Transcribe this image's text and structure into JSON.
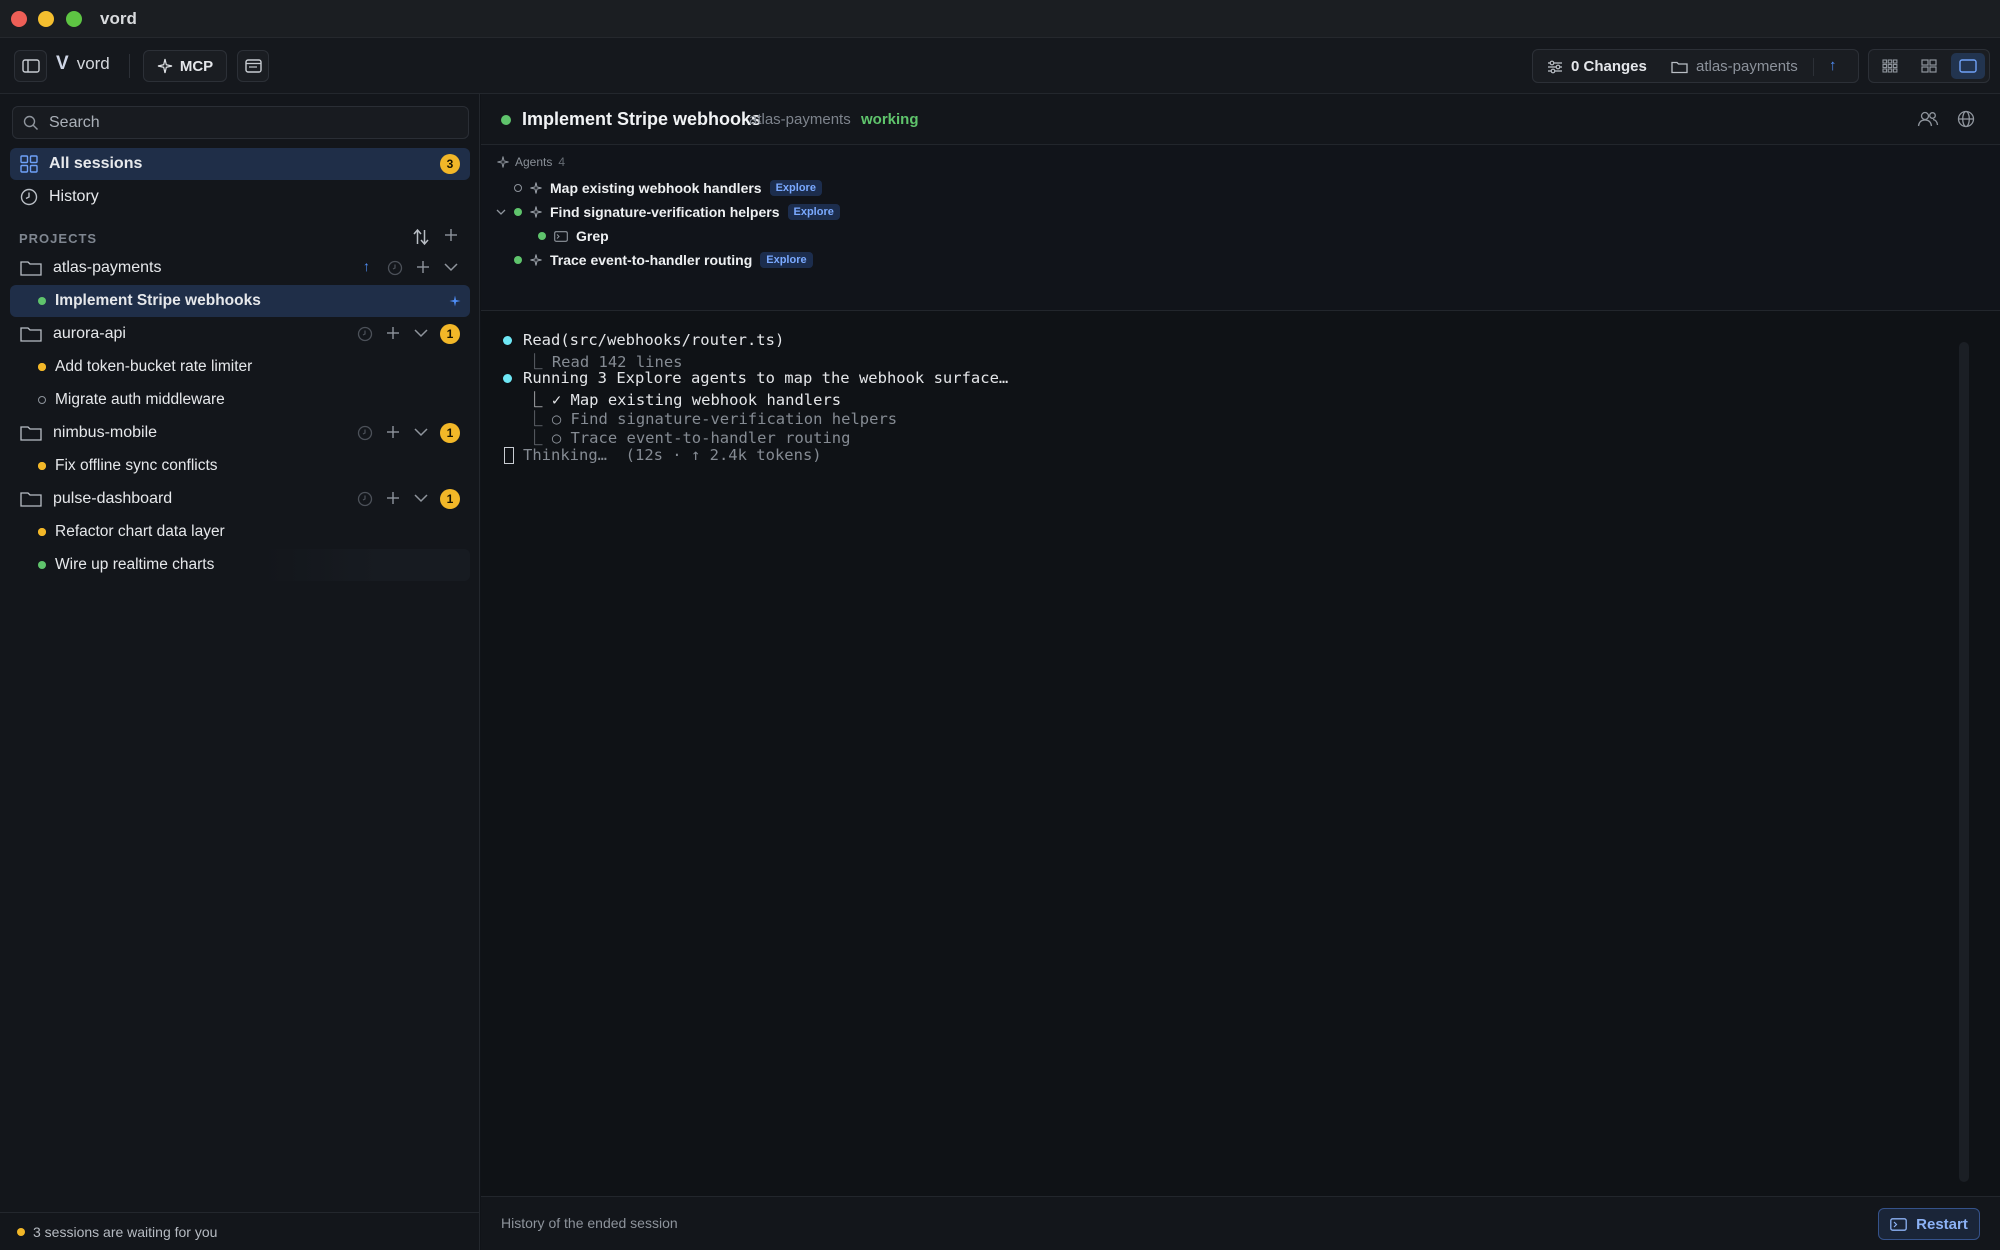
{
  "window": {
    "title": "vord"
  },
  "toolbar": {
    "brand_letter": "V",
    "brand_name": "vord",
    "mcp_label": "MCP",
    "changes_label": "0 Changes",
    "repo_label": "atlas-payments"
  },
  "sidebar": {
    "search_placeholder": "Search",
    "all_sessions_label": "All sessions",
    "all_sessions_count": "3",
    "history_label": "History",
    "projects_heading": "PROJECTS",
    "projects": [
      {
        "name": "atlas-payments",
        "sessions": [
          {
            "label": "Implement Stripe webhooks",
            "status": "running"
          }
        ]
      },
      {
        "name": "aurora-api",
        "badge": "1",
        "sessions": [
          {
            "label": "Add token-bucket rate limiter",
            "status": "waiting"
          },
          {
            "label": "Migrate auth middleware",
            "status": "idle"
          }
        ]
      },
      {
        "name": "nimbus-mobile",
        "badge": "1",
        "sessions": [
          {
            "label": "Fix offline sync conflicts",
            "status": "waiting"
          }
        ]
      },
      {
        "name": "pulse-dashboard",
        "badge": "1",
        "sessions": [
          {
            "label": "Refactor chart data layer",
            "status": "waiting"
          },
          {
            "label": "Wire up realtime charts",
            "status": "running"
          }
        ]
      }
    ],
    "footer_text": "3 sessions are waiting for you"
  },
  "session": {
    "title": "Implement Stripe webhooks",
    "project": "atlas-payments",
    "status": "working"
  },
  "agents": {
    "heading": "Agents",
    "count": "4",
    "items": [
      {
        "label": "Map existing webhook handlers",
        "tag": "Explore"
      },
      {
        "label": "Find signature-verification helpers",
        "tag": "Explore"
      },
      {
        "label": "Grep",
        "tag": ""
      },
      {
        "label": "Trace event-to-handler routing",
        "tag": "Explore"
      }
    ]
  },
  "terminal": {
    "lines": [
      "Read(src/webhooks/router.ts)",
      "⎿ Read 142 lines",
      "Running 3 Explore agents to map the webhook surface…",
      "⎿ ✓ Map existing webhook handlers",
      "⎿ ○ Find signature-verification helpers",
      "⎿ ○ Trace event-to-handler routing",
      "Thinking…  (12s · ↑ 2.4k tokens)"
    ]
  },
  "footer": {
    "text": "History of the ended session",
    "restart_label": "Restart"
  },
  "colors": {
    "accent": "#4f8ef7",
    "running": "#5fc46c",
    "waiting": "#f2b728",
    "terminal_dot": "#6ee7f5"
  }
}
